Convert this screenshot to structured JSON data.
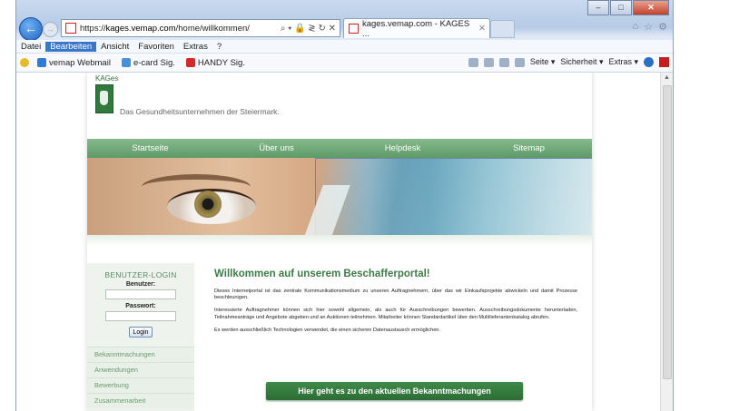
{
  "browser": {
    "caption_buttons": [
      "–",
      "□",
      "✕"
    ],
    "address": {
      "url_prefix": "https://",
      "url_host": "kages.vemap.com",
      "url_path": "/home/willkommen/",
      "tools": "⌕ ▾ 🔒 ≷ ↻ ✕"
    },
    "tab": {
      "title": "kages.vemap.com - KAGES ...",
      "close": "✕"
    },
    "right_icons": [
      "⌂",
      "☆",
      "⚙"
    ],
    "menu": [
      "Datei",
      "Bearbeiten",
      "Ansicht",
      "Favoriten",
      "Extras",
      "?"
    ],
    "menu_active": "Bearbeiten",
    "favorites": [
      {
        "label": "vemap Webmail",
        "color": "#2f7bd6"
      },
      {
        "label": "e-card Sig.",
        "color": "#4a90d9"
      },
      {
        "label": "HANDY Sig.",
        "color": "#d42a2a"
      }
    ],
    "commands": {
      "seite": "Seite ▾",
      "sicherheit": "Sicherheit ▾",
      "extras": "Extras ▾"
    }
  },
  "site": {
    "logo_text": "KAGes",
    "tagline": "Das Gesundheitsunternehmen der Steiermark.",
    "nav": [
      "Startseite",
      "Über uns",
      "Helpdesk",
      "Sitemap"
    ],
    "login": {
      "title": "BENUTZER-LOGIN",
      "user_label": "Benutzer:",
      "password_label": "Passwort:",
      "button": "Login"
    },
    "side_nav": [
      "Bekanntmachungen",
      "Anwendungen",
      "Bewerbung",
      "Zusammenarbeit"
    ],
    "headline": "Willkommen auf unserem Beschafferportal!",
    "paragraphs": [
      "Dieses Internetportal ist das zentrale Kommunikationsmedium zu unseren Auftragnehmern, über das wir Einkaufsprojekte abwickeln und damit Prozesse beschleunigen.",
      "Interessierte Auftragnehmer können sich hier sowohl allgemein, als auch für Ausschreibungen bewerben. Ausschreibungsdokumente herunterladen, Teilnahmeanträge und Angebote abgeben und an Auktionen teilnehmen. Mitarbeiter können Standardartikel über den Multilieferantenkatalog abrufen.",
      "Es werden ausschließlich Technologien verwendet, die einen sicheren Datenaustausch ermöglichen."
    ],
    "cta": "Hier geht es zu den aktuellen Bekanntmachungen",
    "colors": {
      "brand_green": "#3f7a48",
      "nav_green": "#6fa978"
    }
  }
}
